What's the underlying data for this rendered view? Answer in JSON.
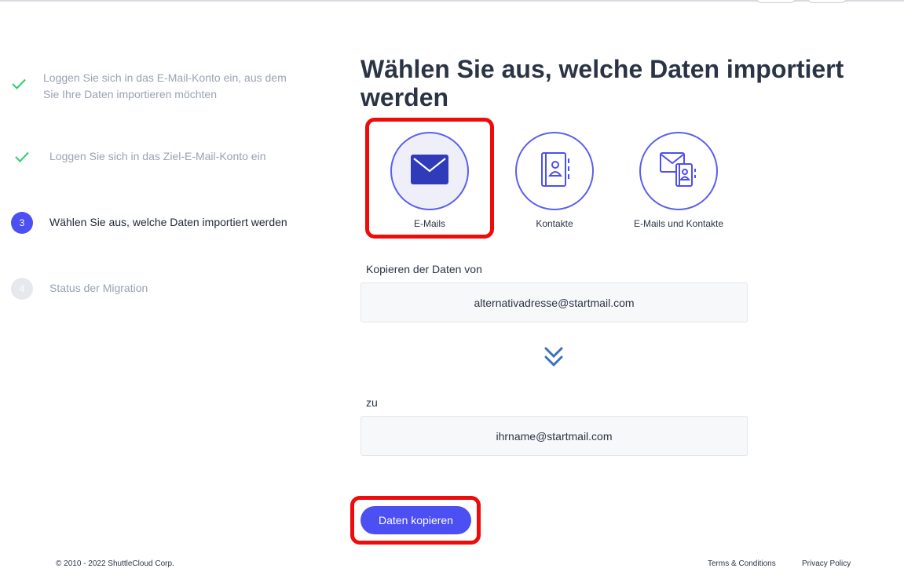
{
  "steps": [
    {
      "status": "done",
      "text": "Loggen Sie sich in das E-Mail-Konto ein, aus dem Sie Ihre Daten importieren möchten"
    },
    {
      "status": "done",
      "text": "Loggen Sie sich in das Ziel-E-Mail-Konto ein"
    },
    {
      "status": "active",
      "number": "3",
      "text": "Wählen Sie aus, welche Daten importiert werden"
    },
    {
      "status": "pending",
      "number": "4",
      "text": "Status der Migration"
    }
  ],
  "main": {
    "title": "Wählen Sie aus, welche Daten importiert werden",
    "options": [
      {
        "label": "E-Mails",
        "icon": "envelope-icon",
        "selected": true
      },
      {
        "label": "Kontakte",
        "icon": "address-book-icon",
        "selected": false
      },
      {
        "label": "E-Mails und Kontakte",
        "icon": "envelope-address-book-icon",
        "selected": false
      }
    ],
    "from_label": "Kopieren der Daten von",
    "from_value": "alternativadresse@startmail.com",
    "to_label": "zu",
    "to_value": "ihrname@startmail.com",
    "copy_button": "Daten kopieren"
  },
  "footer": {
    "copyright": "© 2010 - 2022 ShuttleCloud Corp.",
    "terms": "Terms & Conditions",
    "privacy": "Privacy Policy"
  },
  "colors": {
    "accent": "#4c4ff2",
    "check": "#2ecc71",
    "highlight": "#f00b0b"
  }
}
